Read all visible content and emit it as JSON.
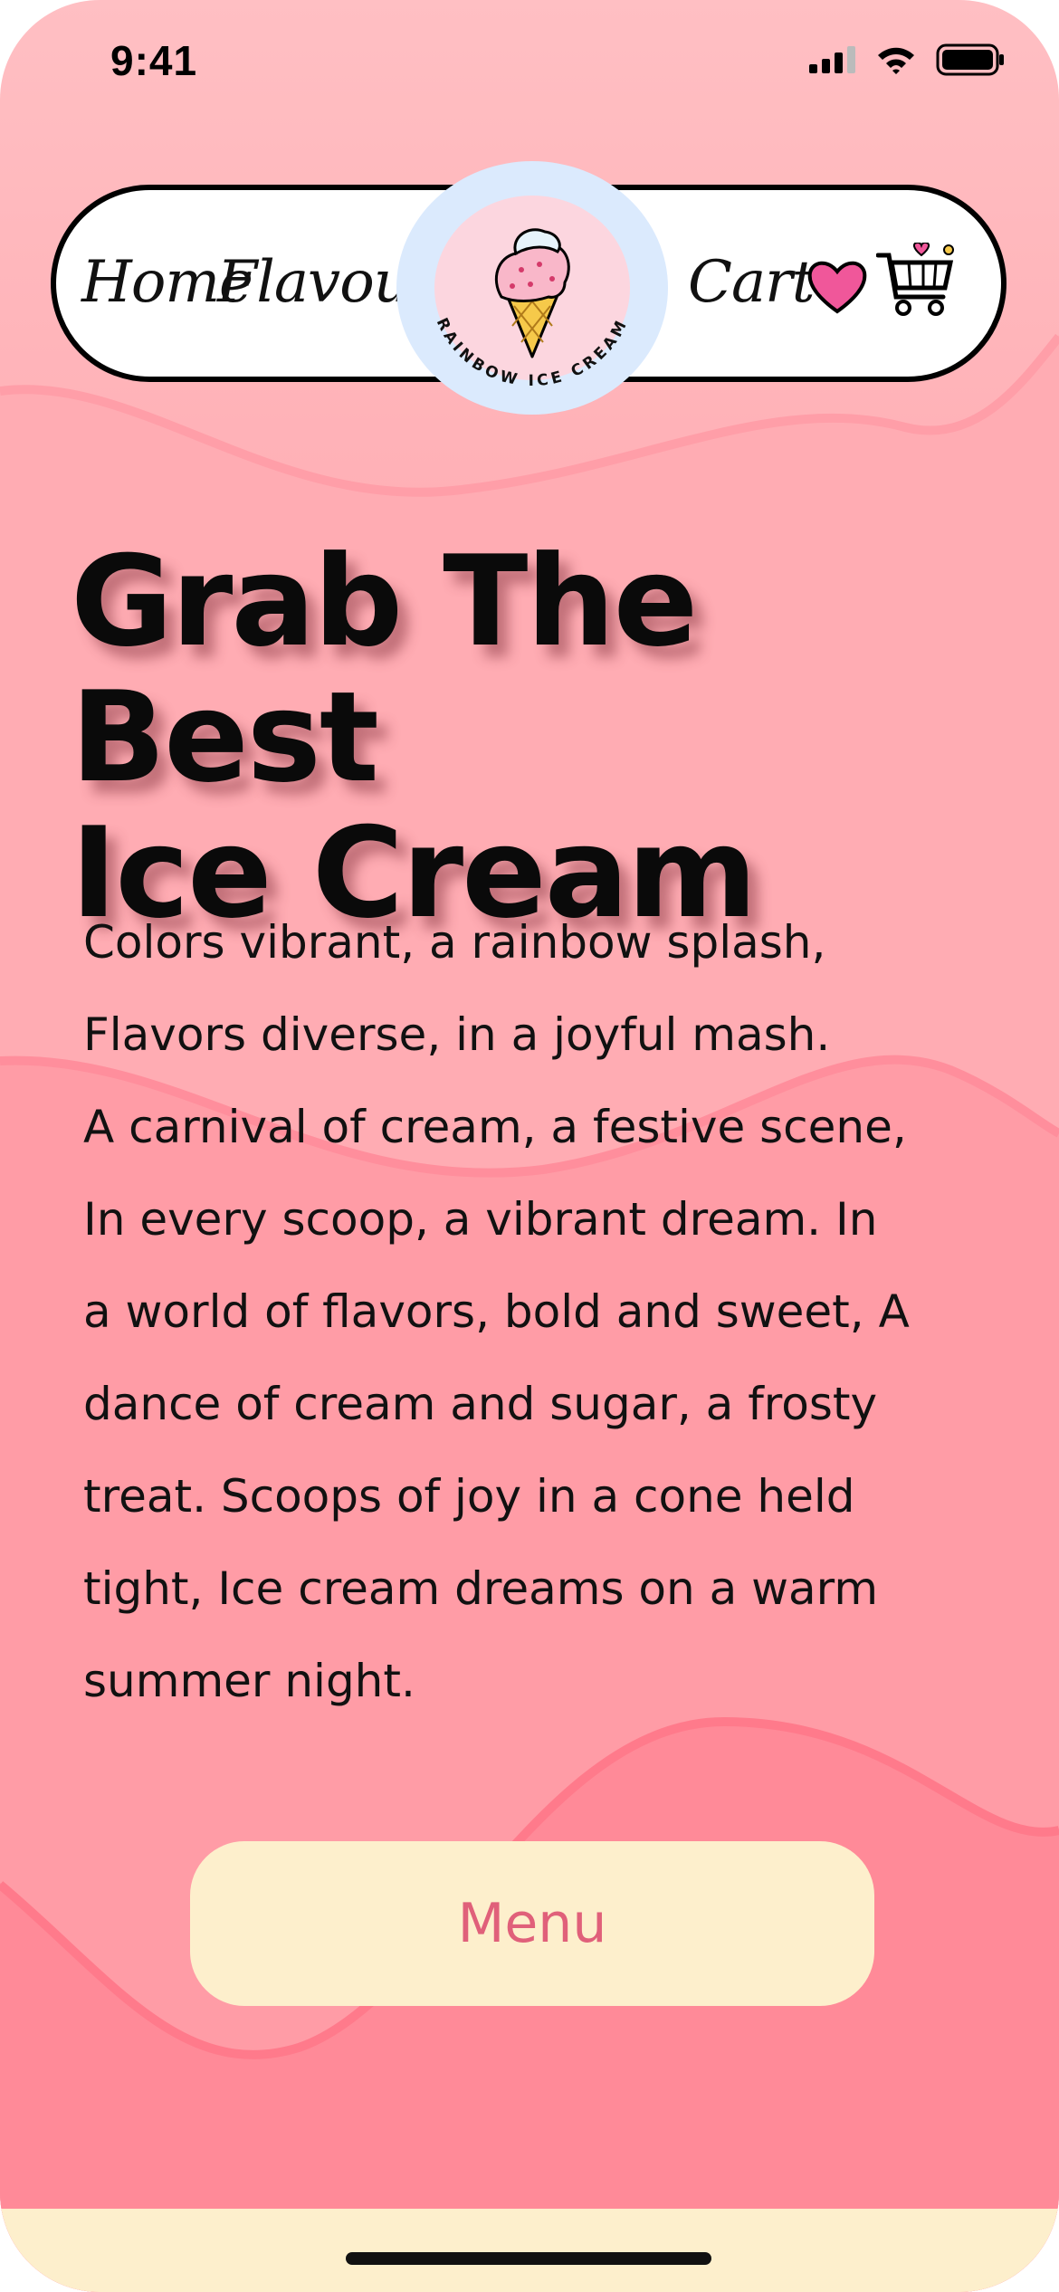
{
  "status_bar": {
    "time": "9:41",
    "icons": [
      "signal-icon",
      "wifi-icon",
      "battery-icon"
    ]
  },
  "nav": {
    "home": "Home",
    "flavours": "Flavours",
    "cart": "Cart",
    "logo_text": "RAINBOW ICE CREAM",
    "icons": [
      "ice-cream-cone-icon",
      "heart-icon",
      "shopping-cart-icon"
    ]
  },
  "hero": {
    "headline_line1": "Grab The Best",
    "headline_line2": "Ice Cream",
    "poem_lines": [
      "Colors vibrant, a rainbow splash,",
      "Flavors diverse, in a joyful mash.",
      "A carnival of cream, a festive scene,",
      "In every scoop, a vibrant dream. In",
      "a world of flavors, bold and sweet, A",
      "dance of cream and sugar, a frosty",
      "treat. Scoops of joy in a cone held",
      "tight, Ice cream dreams on a warm",
      "summer night."
    ]
  },
  "menu_button": {
    "label": "Menu"
  },
  "colors": {
    "background_top": "#ffbfc3",
    "background_bottom": "#ff808f",
    "button_bg": "#fdefcc",
    "button_text": "#e0607a",
    "heart": "#f0579a"
  }
}
